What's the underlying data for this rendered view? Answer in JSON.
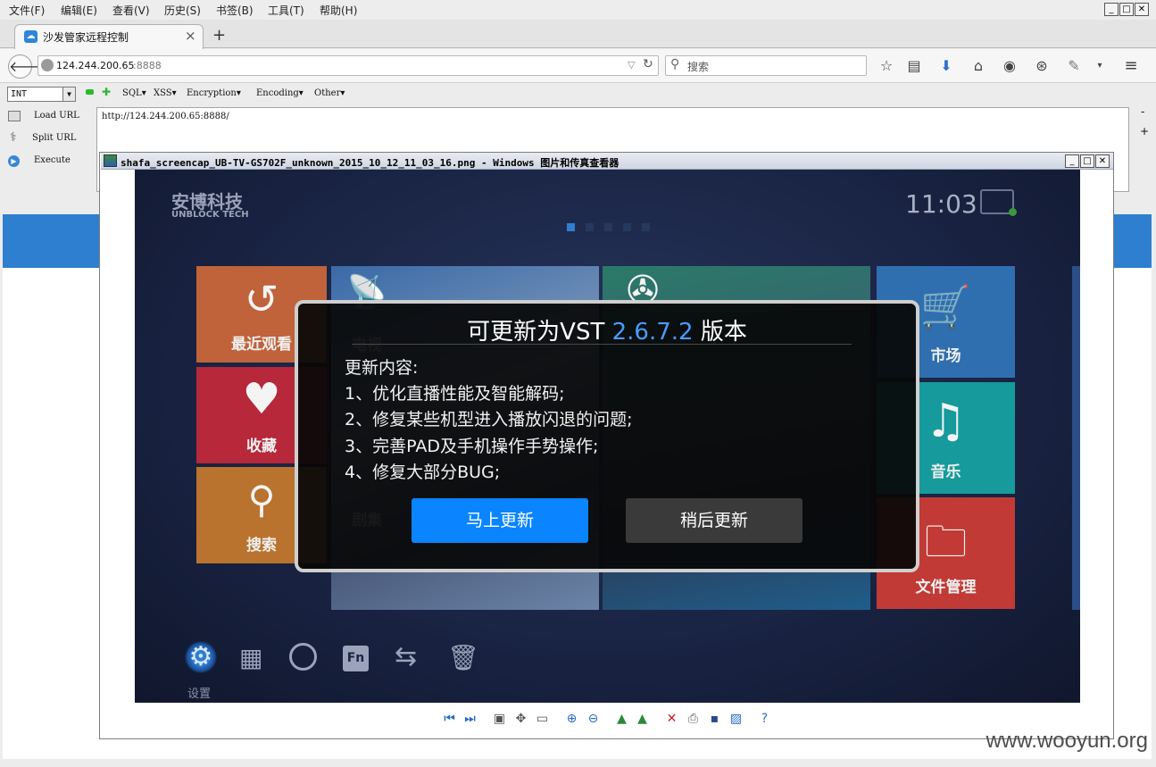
{
  "menubar": {
    "items": [
      "文件(F)",
      "编辑(E)",
      "查看(V)",
      "历史(S)",
      "书签(B)",
      "工具(T)",
      "帮助(H)"
    ],
    "win_min": "_",
    "win_max": "□",
    "win_close": "✕"
  },
  "tab": {
    "title": "沙发管家远程控制",
    "close": "×",
    "new": "+"
  },
  "nav": {
    "url_host": "124.244.200.65",
    "url_port": ":8888",
    "search_placeholder": "搜索"
  },
  "hackbar": {
    "select": "INT",
    "menus": [
      "SQL▾",
      "XSS▾",
      "Encryption▾",
      "Encoding▾",
      "Other▾"
    ],
    "side": [
      "Load URL",
      "Split URL",
      "Execute"
    ],
    "url_value": "http://124.244.200.65:8888/",
    "minus": "-",
    "plus": "+"
  },
  "viewer": {
    "title": "shafa_screencap_UB-TV-GS702F_unknown_2015_10_12_11_03_16.png - Windows 图片和传真查看器"
  },
  "tv": {
    "brand_cn": "安博科技",
    "brand_en": "UNBLOCK TECH",
    "time": "11:03",
    "tiles": {
      "recent": "最近观看",
      "tv": "电视",
      "favorite": "收藏",
      "search": "搜索",
      "drama": "剧集",
      "market": "市场",
      "music": "音乐",
      "files": "文件管理"
    },
    "settings_label": "设置",
    "fn_label": "Fn"
  },
  "dialog": {
    "title_prefix": "可更新为VST ",
    "version": "2.6.7.2",
    "title_suffix": " 版本",
    "heading": "更新内容:",
    "lines": [
      "1、优化直播性能及智能解码;",
      "2、修复某些机型进入播放闪退的问题;",
      "3、完善PAD及手机操作手势操作;",
      "4、修复大部分BUG;"
    ],
    "update_now": "马上更新",
    "update_later": "稍后更新"
  },
  "watermark": "www.wooyun.org",
  "colors": {
    "accent_blue": "#0a84ff",
    "tile_orange": "#c0623a",
    "tile_teal": "#169a9c",
    "tile_red": "#c23a35",
    "tile_blue": "#2f6fb0",
    "page_blue": "#2f7fd0"
  }
}
